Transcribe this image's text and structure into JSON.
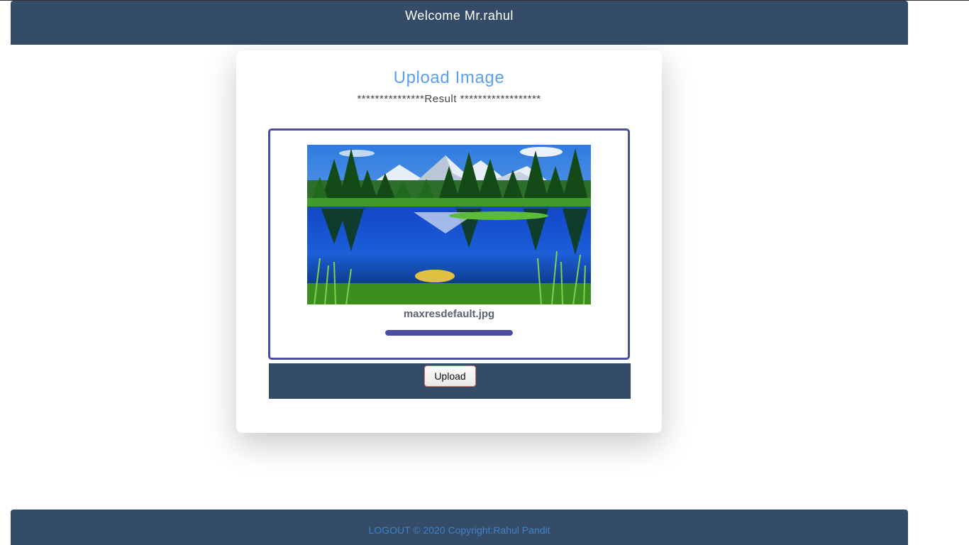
{
  "header": {
    "welcome_text": "Welcome Mr.rahul"
  },
  "card": {
    "title": "Upload Image",
    "result_text": "***************Result ******************",
    "file": {
      "name": "maxresdefault.jpg",
      "progress": 1.0
    },
    "upload_label": "Upload"
  },
  "footer": {
    "logout_label": "LOGOUT",
    "copyright": " © 2020 Copyright:Rahul Pandit"
  },
  "colors": {
    "header_bg": "#344c67",
    "title_blue": "#5b9ff0",
    "dropzone_border": "#4a4ea3",
    "footer_link": "#3f82c9"
  }
}
